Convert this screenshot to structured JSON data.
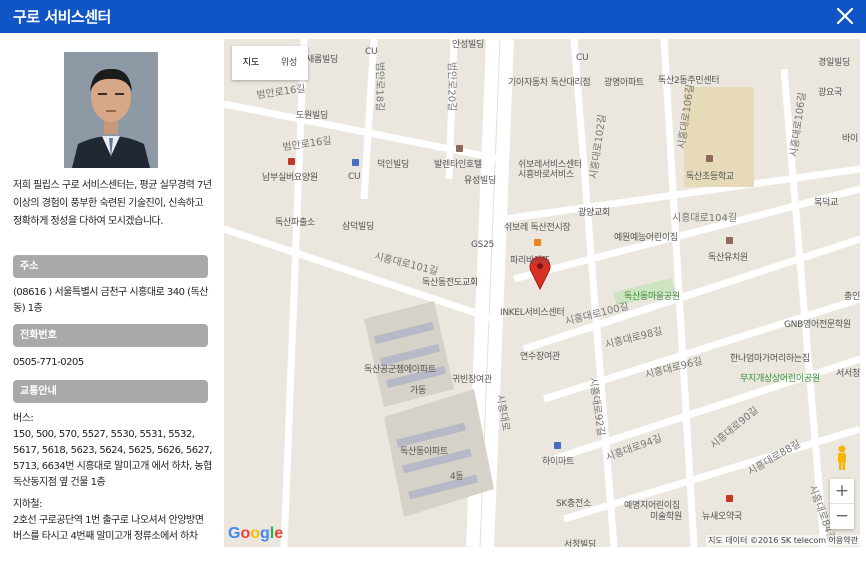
{
  "header": {
    "title": "구로 서비스센터"
  },
  "left": {
    "intro": "저희 필립스 구로 서비스센터는, 평균 실무경력 7년 이상의 경험이 풍부한 숙련된 기술진이, 신속하고 정확하게 정성을 다하여 모시겠습니다.",
    "address": {
      "heading": "주소",
      "text": "(08616 ) 서울특별시 금천구 시흥대로 340 (독산동) 1층"
    },
    "phone": {
      "heading": "전화번호",
      "text": "0505-771-0205"
    },
    "transit": {
      "heading": "교통안내",
      "bus_label": "버스:",
      "bus_text": "150, 500, 570, 5527, 5530, 5531, 5532, 5617, 5618, 5623, 5624, 5625, 5626, 5627, 5713, 6634번 시흥대로 말미고개 에서 하차, 농협 독산동지점 옆 건물 1층",
      "subway_label": "지하철:",
      "subway_text": "2호선 구로공단역 1번 출구로 나오셔서 안양방면 버스를 타시고 4번째 말미고개 정류소에서 하차"
    }
  },
  "map": {
    "type_map": "지도",
    "type_satellite": "위성",
    "zoom_in": "+",
    "zoom_out": "−",
    "google": [
      "G",
      "o",
      "o",
      "g",
      "l",
      "e"
    ],
    "attribution": "지도 데이터 ©2016 SK telecom   이용약관",
    "labels": {
      "saerom": "새롬빌딩",
      "cu1": "CU",
      "ansung": "안성빌딩",
      "cu2": "CU",
      "kia": "기아자동차 독산대리점",
      "gwangmyeong": "광명아파트",
      "dongsan2": "독산2동주민센터",
      "gyeongil": "경일빌딩",
      "gwangyakguk": "광요국",
      "beoman16": "범안로16길",
      "dowon": "도원빌딩",
      "beoman16b": "범안로16길",
      "namboo": "남부실버요양원",
      "cu3": "CU",
      "deokin": "덕인빌딩",
      "baltain": "발렌타인호텔",
      "yuseong": "유성빌딩",
      "swiboream1": "쉬보레서비스센터",
      "swiboream2": "시흥바로서비스",
      "dongsan_school": "독산초등학교",
      "bokdeok": "복덕교",
      "dongsan_police": "독산파출소",
      "samdeok": "삼덕빌딩",
      "gs25": "GS25",
      "swiboream3": "쉬보레 독산전시장",
      "gwangyanggyo": "광양교회",
      "yewon": "예원예능어린이집",
      "siheung104": "시흥대로104길",
      "paris": "파리바게뜨",
      "dongsan_yuchi": "독산유치원",
      "siheung101": "시흥대로101길",
      "dongsan_church": "독산동전도교회",
      "inkel": "INKEL서비스센터",
      "dongsan_park": "독산동마을공원",
      "siheung100": "시흥대로100길",
      "siheung98": "시흥대로98길",
      "gnb": "GNB영어전문학원",
      "yeonsu": "연수장여관",
      "dongsan_apt1": "독산공군쳄에아파트",
      "gaba": "가동",
      "gwibyeon": "귀빈장여관",
      "siheungdaero": "시흥대로",
      "hanneum": "한나엄마가머리하는집",
      "siheung96": "시흥대로96길",
      "muji": "무지개상상어린이공원",
      "dongsan_apt2": "독산동아파트",
      "dong4": "4동",
      "siheung94": "시흥대로94길",
      "himart": "하이마트",
      "siheung90": "시흥대로90길",
      "siheung88": "시흥대로88길",
      "sk": "SK충전소",
      "yemyeong": "예명지어린이집",
      "misul": "미술학원",
      "nyuse": "뉴새오약국",
      "seojeong": "서정빌딩",
      "siheung92": "시흥대로92길",
      "siheung102": "시흥대로102길",
      "siheung106": "시흥대로106길",
      "siheung106b": "시흥대로106길",
      "beoman18": "범안로18길",
      "beoman20": "범안로20길",
      "siheung84": "시흥대로84길",
      "bai": "바이",
      "jeong": "충인",
      "seoseong": "서서청"
    }
  },
  "colors": {
    "header": "#0f55c5",
    "section_header": "#a9a9a9",
    "pin": "#d93025",
    "map_bg": "#ebe7df"
  }
}
